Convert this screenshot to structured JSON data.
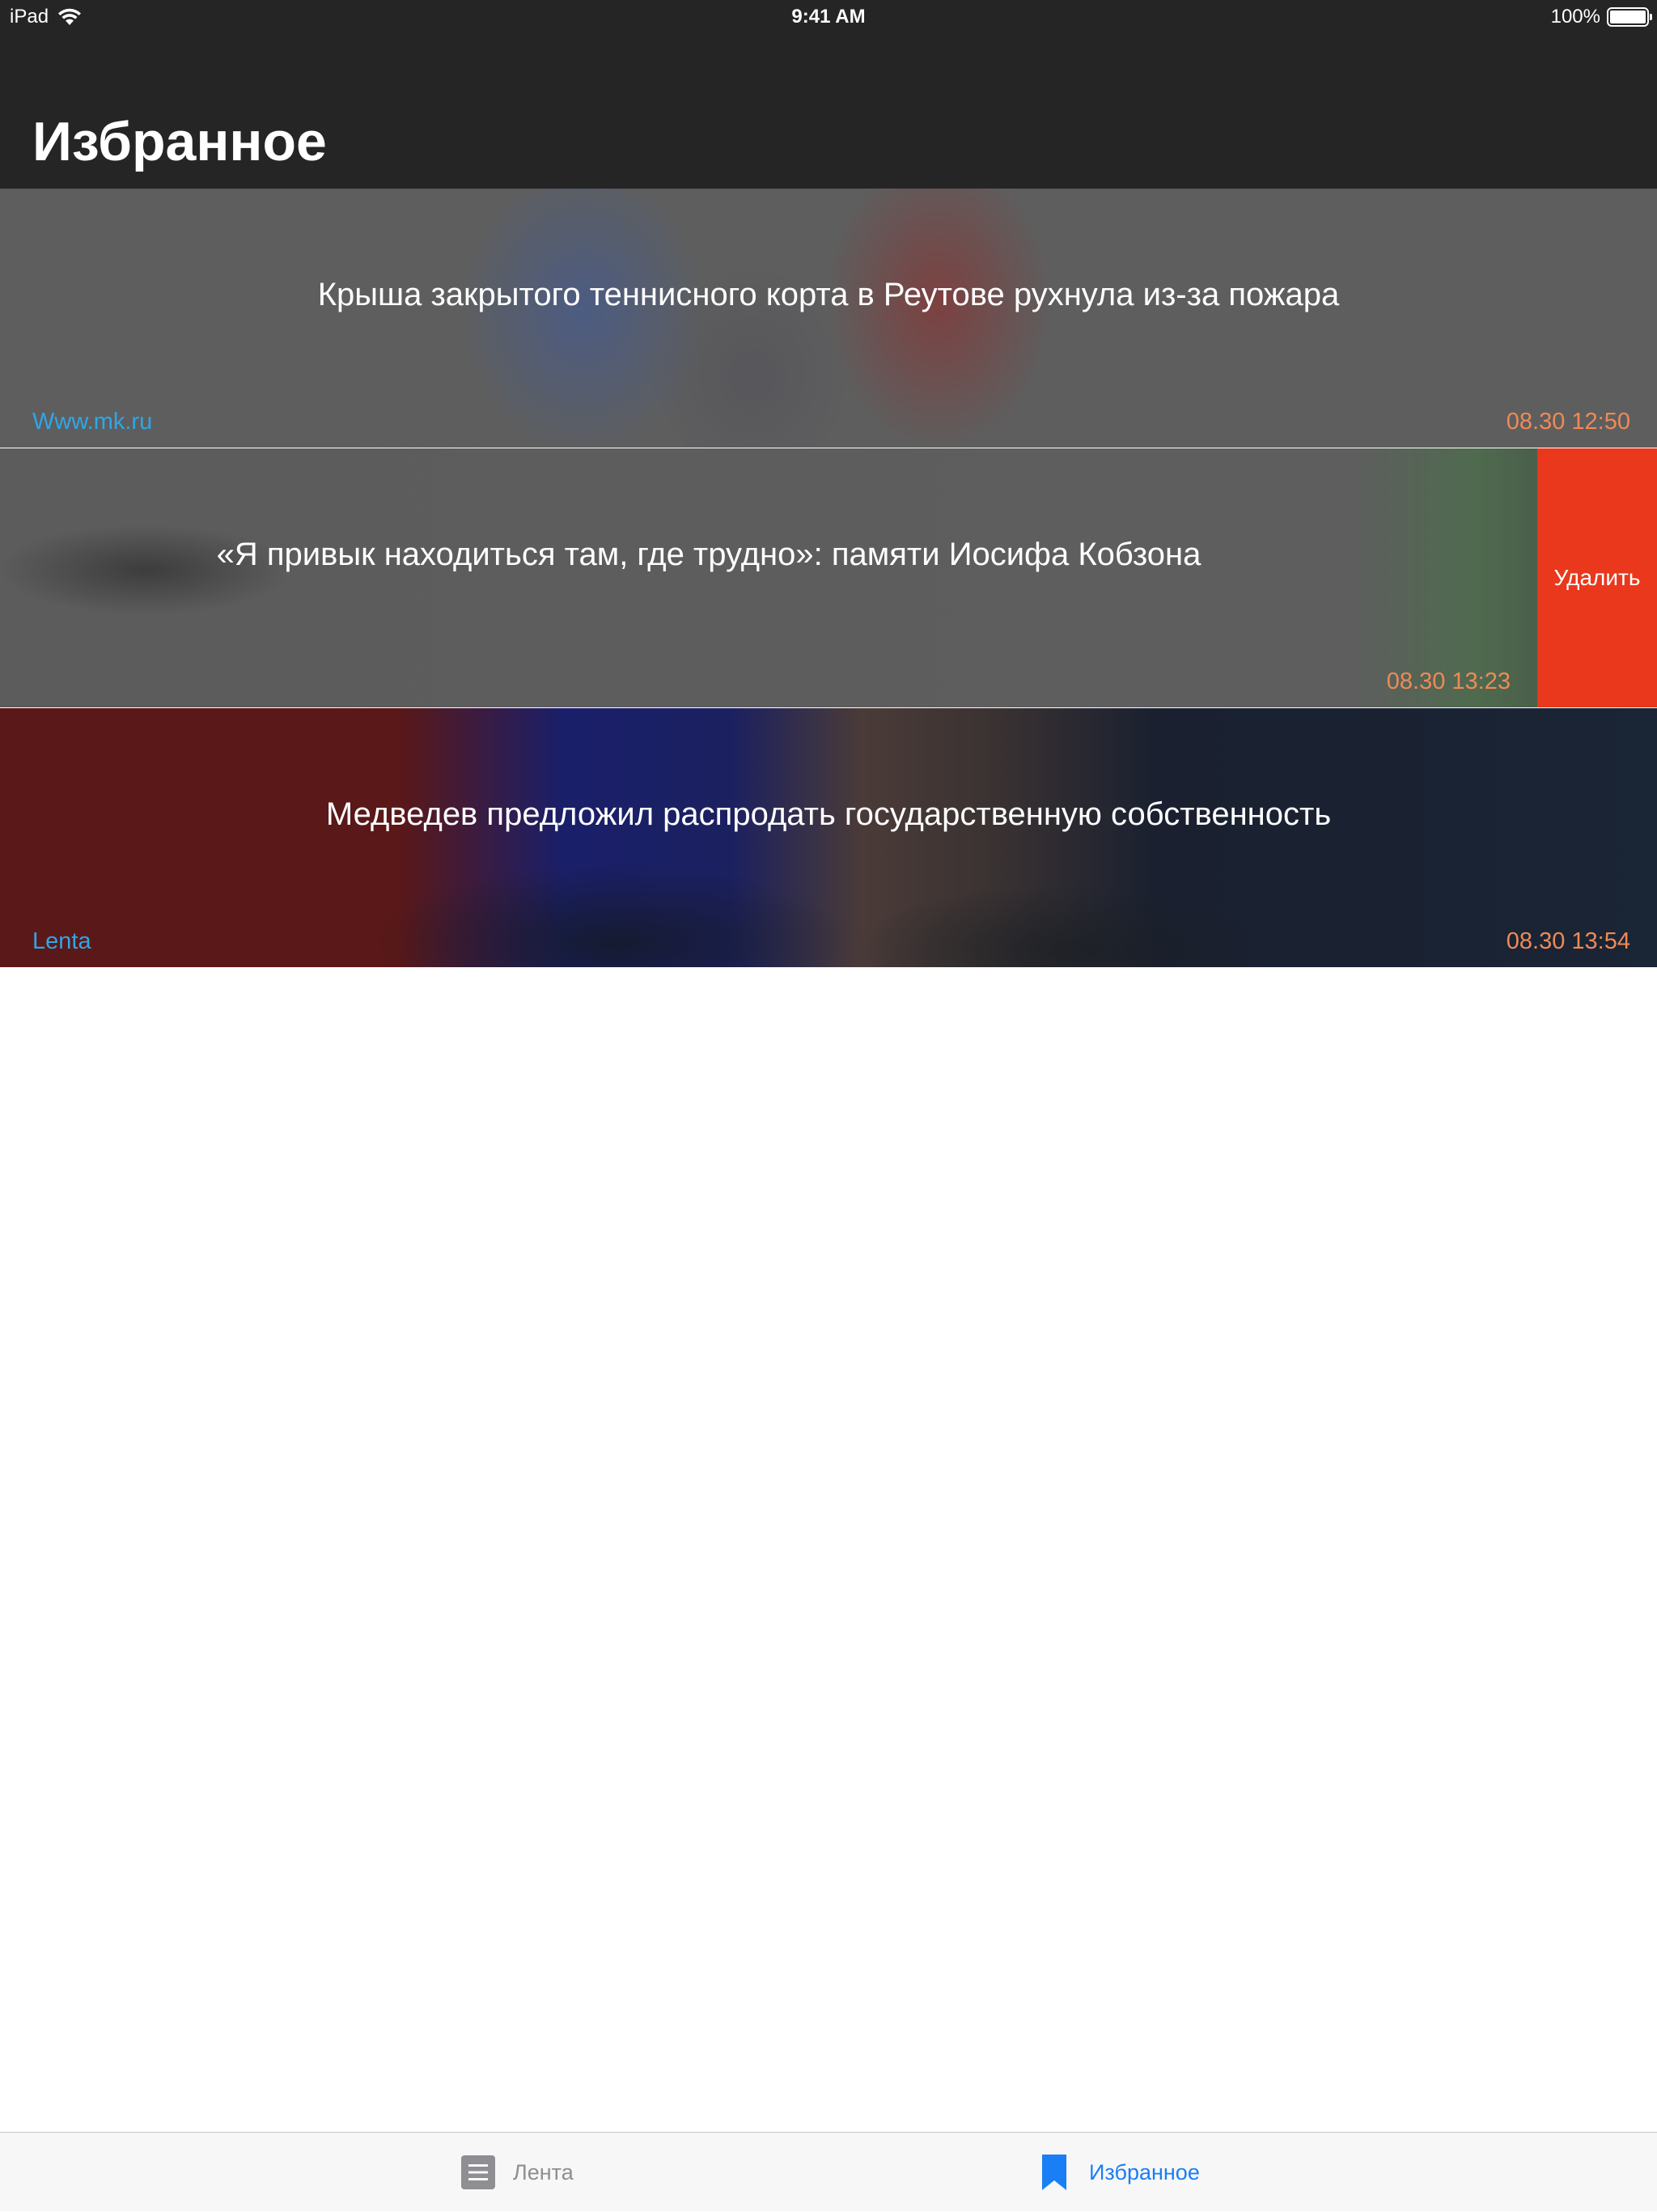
{
  "status_bar": {
    "device": "iPad",
    "time": "9:41 AM",
    "battery": "100%",
    "battery_level": 1.0
  },
  "header": {
    "title": "Избранное"
  },
  "news": [
    {
      "title": "Крыша закрытого теннисного корта в Реутове рухнула из-за пожара",
      "source": "Www.mk.ru",
      "time": "08.30 12:50"
    },
    {
      "title": "«Я привык находиться там, где трудно»: памяти Иосифа Кобзона",
      "source": "",
      "time": "08.30 13:23",
      "delete_label": "Удалить"
    },
    {
      "title": "Медведев предложил распродать государственную собственность",
      "source": "Lenta",
      "time": "08.30 13:54"
    }
  ],
  "tab_bar": {
    "tabs": [
      {
        "label": "Лента",
        "icon": "list-icon",
        "active": false
      },
      {
        "label": "Избранное",
        "icon": "bookmark-icon",
        "active": true
      }
    ]
  },
  "colors": {
    "header_bg": "#252525",
    "source_link": "#2ea6e8",
    "timestamp": "#ef8a55",
    "delete_bg": "#e9381c",
    "tab_active": "#1a7ef5",
    "tab_inactive": "#8e8e93"
  }
}
